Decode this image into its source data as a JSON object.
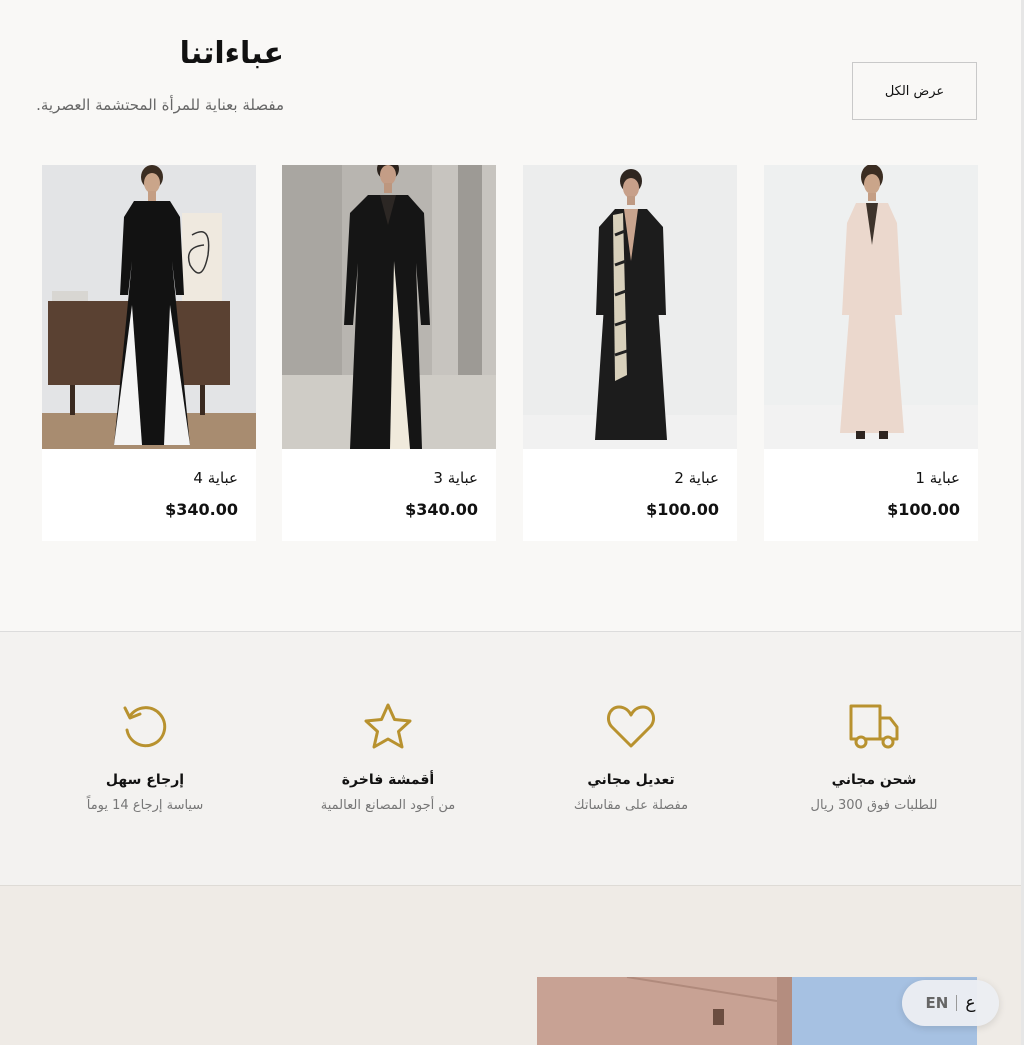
{
  "header": {
    "title": "عباءاتنا",
    "subtitle": "مفصلة بعناية للمرأة المحتشمة العصرية.",
    "view_all_label": "عرض الكل"
  },
  "products": [
    {
      "name": "عباية 1",
      "price": "$100.00"
    },
    {
      "name": "عباية 2",
      "price": "$100.00"
    },
    {
      "name": "عباية 3",
      "price": "$340.00"
    },
    {
      "name": "عباية 4",
      "price": "$340.00"
    }
  ],
  "features": [
    {
      "icon": "truck-icon",
      "title": "شحن مجاني",
      "subtitle": "للطلبات فوق 300 ريال"
    },
    {
      "icon": "heart-icon",
      "title": "تعديل مجاني",
      "subtitle": "مفصلة على مقاساتك"
    },
    {
      "icon": "star-icon",
      "title": "أقمشة فاخرة",
      "subtitle": "من أجود المصانع العالمية"
    },
    {
      "icon": "return-icon",
      "title": "إرجاع سهل",
      "subtitle": "سياسة إرجاع 14 يوماً"
    }
  ],
  "language_switcher": {
    "en": "EN",
    "ar": "ع"
  },
  "colors": {
    "accent_gold": "#b8922f",
    "page_bg": "#f9f8f6",
    "features_bg": "#f3f2f0",
    "bottom_bg": "#efebe6"
  }
}
